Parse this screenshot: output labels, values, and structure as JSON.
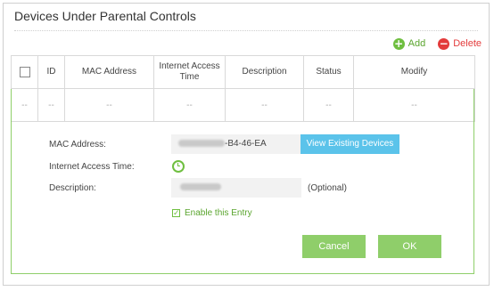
{
  "panel": {
    "title": "Devices Under Parental Controls"
  },
  "actions": {
    "add_label": "Add",
    "delete_label": "Delete",
    "add_icon": "plus-circle-icon",
    "delete_icon": "minus-circle-icon"
  },
  "table": {
    "headers": [
      "",
      "ID",
      "MAC Address",
      "Internet Access Time",
      "Description",
      "Status",
      "Modify"
    ],
    "row": [
      "--",
      "--",
      "--",
      "--",
      "--",
      "--",
      "--"
    ]
  },
  "form": {
    "mac_label": "MAC Address:",
    "mac_value_visible": "-B4-46-EA",
    "view_devices_label": "View Existing Devices",
    "access_time_label": "Internet Access Time:",
    "access_time_icon": "clock-icon",
    "description_label": "Description:",
    "optional_label": "(Optional)",
    "enable_label": "Enable this Entry",
    "enable_checked": true,
    "cancel_label": "Cancel",
    "ok_label": "OK"
  },
  "colors": {
    "accent_green": "#8fce6a",
    "blue_button": "#5bc3ea",
    "delete_red": "#e33b3b"
  }
}
